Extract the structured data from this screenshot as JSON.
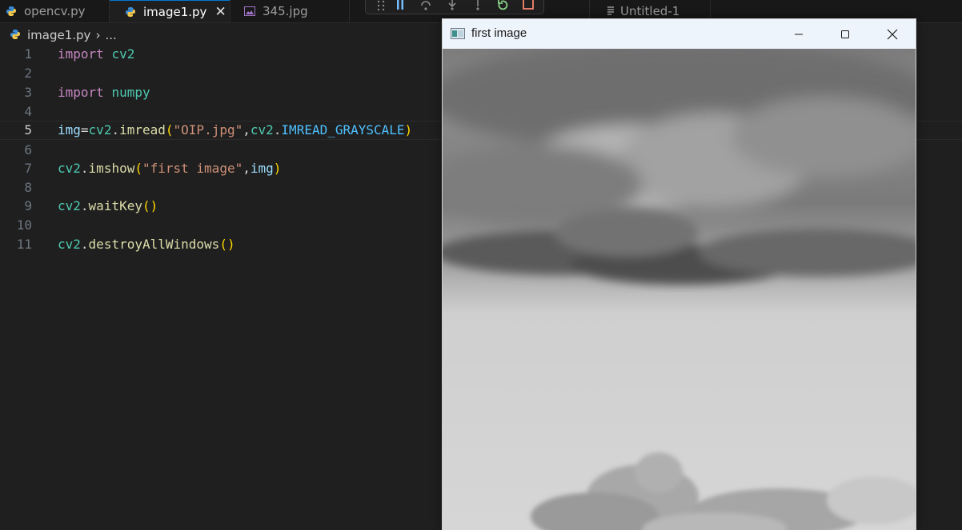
{
  "tabs": [
    {
      "label": "opencv.py",
      "icon": "python-icon"
    },
    {
      "label": "image1.py",
      "icon": "python-icon",
      "active": true,
      "close": "✕"
    },
    {
      "label": "345.jpg",
      "icon": "image-file-icon"
    },
    {
      "label": "Untitled-1",
      "icon": "text-file-icon"
    }
  ],
  "breadcrumb": {
    "file": "image1.py",
    "separator": "›",
    "more": "..."
  },
  "editor": {
    "line_numbers": [
      "1",
      "2",
      "3",
      "4",
      "5",
      "6",
      "7",
      "8",
      "9",
      "10",
      "11"
    ],
    "current_line": "5",
    "code": {
      "l1_kw": "import",
      "l1_mod": "cv2",
      "l3_kw": "import",
      "l3_mod": "numpy",
      "l5_var": "img",
      "l5_eq": "=",
      "l5_mod": "cv2",
      "l5_dot": ".",
      "l5_fn": "imread",
      "l5_po": "(",
      "l5_str": "\"OIP.jpg\"",
      "l5_comma": ",",
      "l5_mod2": "cv2",
      "l5_dot2": ".",
      "l5_const": "IMREAD_GRAYSCALE",
      "l5_pc": ")",
      "l7_mod": "cv2",
      "l7_dot": ".",
      "l7_fn": "imshow",
      "l7_po": "(",
      "l7_str": "\"first image\"",
      "l7_comma": ",",
      "l7_var": "img",
      "l7_pc": ")",
      "l9_mod": "cv2",
      "l9_dot": ".",
      "l9_fn": "waitKey",
      "l9_p": "()",
      "l11_mod": "cv2",
      "l11_dot": ".",
      "l11_fn": "destroyAllWindows",
      "l11_p": "()"
    }
  },
  "cv_window": {
    "title": "first image",
    "buttons": [
      "minimize-icon",
      "maximize-icon",
      "close-icon"
    ]
  },
  "debug_toolbar": [
    "drag-handle-icon",
    "pause-icon",
    "step-over-icon",
    "step-into-icon",
    "step-out-icon",
    "restart-icon",
    "stop-icon"
  ],
  "colors": {
    "editor_bg": "#1f1f1f",
    "tab_active_accent": "#0078d4",
    "keyword": "#c586c0",
    "module": "#4ec9b0",
    "string": "#ce9178",
    "function": "#dcdcaa"
  }
}
